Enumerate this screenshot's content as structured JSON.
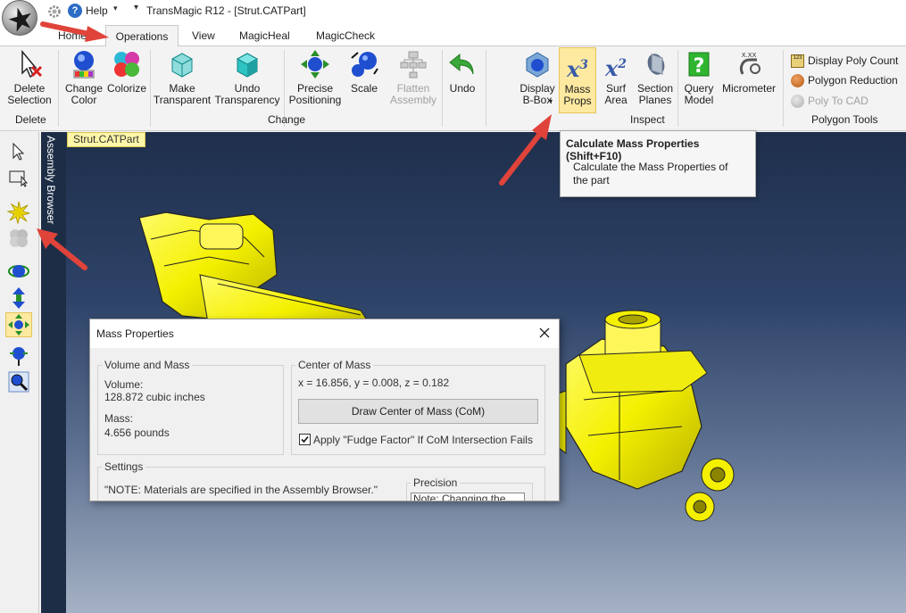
{
  "titlebar": {
    "help_label": "Help",
    "title": "TransMagic R12 - [Strut.CATPart]"
  },
  "tabs": [
    {
      "label": "Home"
    },
    {
      "label": "Operations"
    },
    {
      "label": "View"
    },
    {
      "label": "MagicHeal"
    },
    {
      "label": "MagicCheck"
    }
  ],
  "ribbon": {
    "delete_group": {
      "label": "Delete",
      "delete_selection": "Delete\nSelection"
    },
    "change_group": {
      "label": "Change",
      "change_color": "Change\nColor",
      "colorize": "Colorize",
      "make_transparent": "Make\nTransparent",
      "undo_transparency": "Undo\nTransparency",
      "precise_positioning": "Precise\nPositioning",
      "scale": "Scale",
      "flatten_assembly": "Flatten\nAssembly",
      "undo": "Undo"
    },
    "inspect_group": {
      "label": "Inspect",
      "display_bbox": "Display\nB-Box",
      "mass_props": "Mass\nProps",
      "surf_area": "Surf\nArea",
      "section_planes": "Section\nPlanes",
      "query_model": "Query\nModel",
      "micrometer": "Micrometer"
    },
    "polygon_group": {
      "label": "Polygon Tools",
      "display_poly_count": "Display Poly Count",
      "polygon_reduction": "Polygon Reduction",
      "poly_to_cad": "Poly To CAD"
    }
  },
  "sidebar": {
    "assembly_browser": "Assembly Browser"
  },
  "document_tab": "Strut.CATPart",
  "tooltip": {
    "title": "Calculate Mass Properties (Shift+F10)",
    "body": "Calculate the Mass Properties of the part"
  },
  "dialog": {
    "title": "Mass Properties",
    "volume_mass": {
      "legend": "Volume and Mass",
      "volume_label": "Volume:",
      "volume_value": "128.872  cubic inches",
      "mass_label": "Mass:",
      "mass_value": "4.656 pounds"
    },
    "center_of_mass": {
      "legend": "Center of Mass",
      "coords": "x = 16.856, y = 0.008, z = 0.182",
      "draw_button": "Draw Center of Mass (CoM)",
      "fudge_checkbox": "Apply \"Fudge Factor\" If CoM Intersection Fails",
      "fudge_checked": true
    },
    "settings": {
      "legend": "Settings",
      "note": "\"NOTE: Materials are specified in the Assembly Browser.\"",
      "precision_legend": "Precision",
      "precision_note": "Note: Changing the"
    }
  },
  "colors": {
    "annotation_arrow": "#e0433a",
    "part_yellow": "#f4f000",
    "viewport_top": "#1f2f4c",
    "viewport_bottom": "#a5b1c4"
  }
}
